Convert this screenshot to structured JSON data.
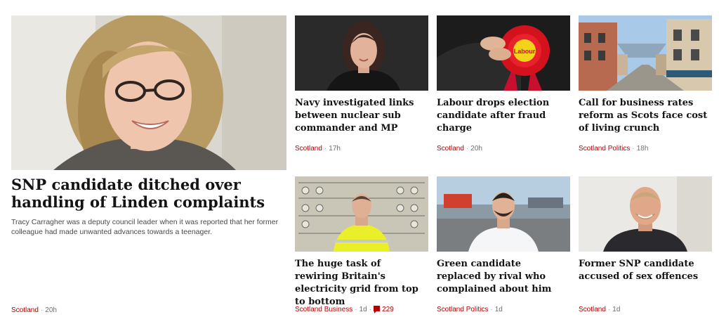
{
  "colors": {
    "section": "#b80000",
    "meta": "#6e6e73",
    "headline": "#141414"
  },
  "lead": {
    "title": "SNP candidate ditched over handling of Linden complaints",
    "summary": "Tracy Carragher was a deputy council leader when it was reported that her former colleague had made unwanted advances towards a teenager.",
    "section": "Scotland",
    "time": "20h"
  },
  "stories": [
    {
      "title": "Navy investigated links between nuclear sub commander and MP",
      "section": "Scotland",
      "time": "17h"
    },
    {
      "title": "Labour drops election candidate after fraud charge",
      "section": "Scotland",
      "time": "20h"
    },
    {
      "title": "Call for business rates reform as Scots face cost of living crunch",
      "section": "Scotland Politics",
      "time": "18h"
    },
    {
      "title": "The huge task of rewiring Britain's electricity grid from top to bottom",
      "section": "Scotland Business",
      "time": "1d",
      "comments": "229"
    },
    {
      "title": "Green candidate replaced by rival who complained about him",
      "section": "Scotland Politics",
      "time": "1d"
    },
    {
      "title": "Former SNP candidate accused of sex offences",
      "section": "Scotland",
      "time": "1d"
    }
  ],
  "rosette_text": "Labour",
  "separator": "·"
}
